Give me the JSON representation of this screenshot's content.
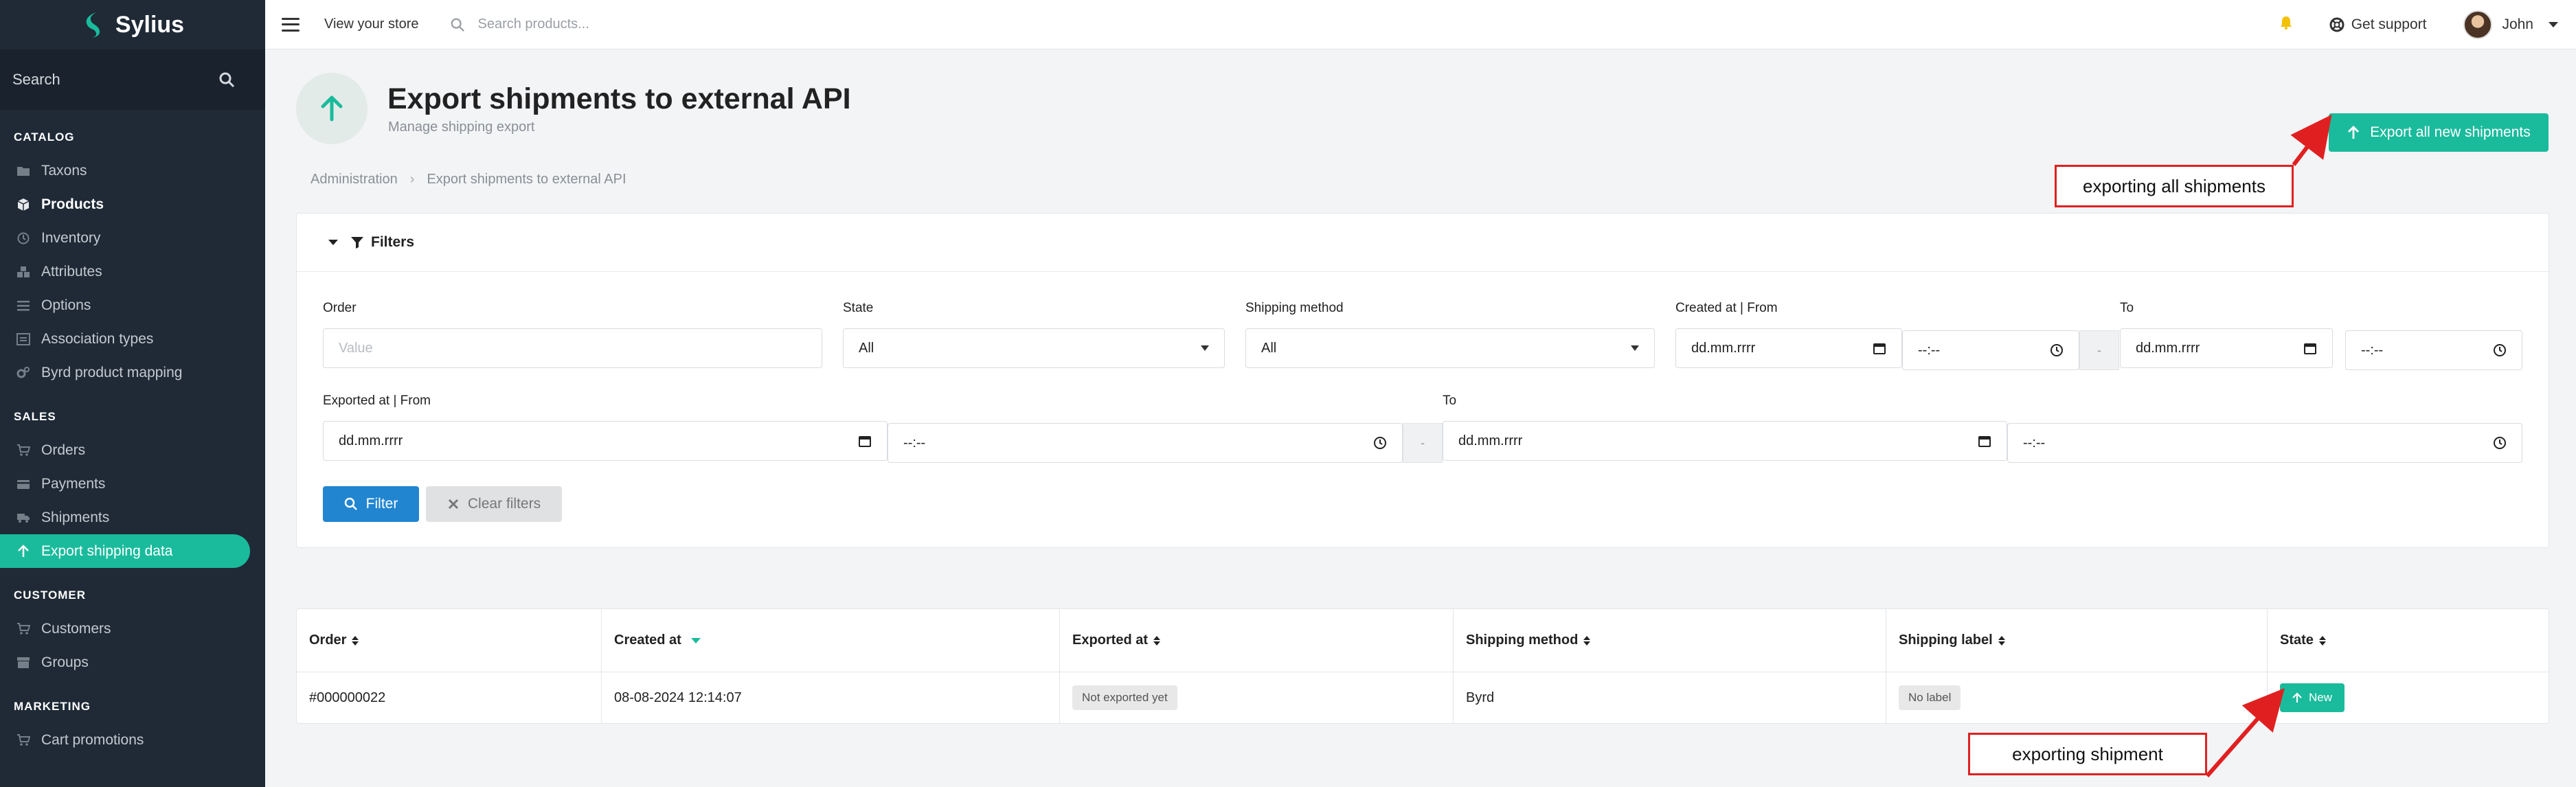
{
  "app": {
    "name": "Sylius"
  },
  "sidebar": {
    "search_label": "Search",
    "sections": [
      {
        "title": "CATALOG",
        "items": [
          "Taxons",
          "Products",
          "Inventory",
          "Attributes",
          "Options",
          "Association types",
          "Byrd product mapping"
        ]
      },
      {
        "title": "SALES",
        "items": [
          "Orders",
          "Payments",
          "Shipments",
          "Export shipping data"
        ]
      },
      {
        "title": "CUSTOMER",
        "items": [
          "Customers",
          "Groups"
        ]
      },
      {
        "title": "MARKETING",
        "items": [
          "Cart promotions"
        ]
      }
    ],
    "active_item": "Export shipping data"
  },
  "topbar": {
    "view_store": "View your store",
    "search_placeholder": "Search products...",
    "support": "Get support",
    "user": "John"
  },
  "header": {
    "title": "Export shipments to external API",
    "subtitle": "Manage shipping export",
    "export_all_label": "Export all new shipments"
  },
  "breadcrumb": [
    "Administration",
    "Export shipments to external API"
  ],
  "filters": {
    "title": "Filters",
    "order_label": "Order",
    "order_placeholder": "Value",
    "state_label": "State",
    "state_value": "All",
    "shipping_method_label": "Shipping method",
    "shipping_method_value": "All",
    "created_from_label": "Created at | From",
    "to_label": "To",
    "exported_from_label": "Exported at | From",
    "date_placeholder": "dd.mm.rrrr",
    "time_placeholder": "--:--",
    "dash": "-",
    "filter_button": "Filter",
    "clear_button": "Clear filters"
  },
  "table": {
    "columns": [
      "Order",
      "Created at",
      "Exported at",
      "Shipping method",
      "Shipping label",
      "State"
    ],
    "rows": [
      {
        "order": "#000000022",
        "created_at": "08-08-2024 12:14:07",
        "exported_at": "Not exported yet",
        "shipping_method": "Byrd",
        "shipping_label": "No label",
        "state": "New"
      }
    ]
  },
  "annotations": {
    "export_all": "exporting all shipments",
    "export_one": "exporting shipment"
  },
  "colors": {
    "accent": "#1abb9c",
    "primary": "#2185d0",
    "sidebar": "#1f2a36",
    "annotation": "#e02020"
  }
}
